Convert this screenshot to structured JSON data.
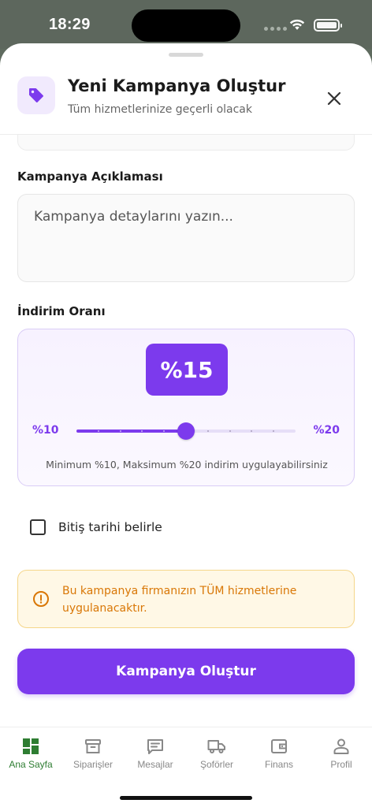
{
  "status_bar": {
    "time": "18:29"
  },
  "header": {
    "title": "Yeni Kampanya Oluştur",
    "subtitle": "Tüm hizmetlerinize geçerli olacak"
  },
  "description": {
    "label": "Kampanya Açıklaması",
    "placeholder": "Kampanya detaylarını yazın...",
    "value": ""
  },
  "discount": {
    "label": "İndirim Oranı",
    "display": "%15",
    "value": 15,
    "min": 10,
    "max": 20,
    "min_label": "%10",
    "max_label": "%20",
    "helper": "Minimum %10, Maksimum %20 indirim uygulayabilirsiniz",
    "accent_color": "#7c3aed"
  },
  "end_date": {
    "label": "Bitiş tarihi belirle",
    "checked": false
  },
  "info": {
    "text": "Bu kampanya firmanızın TÜM hizmetlerine uygulanacaktır."
  },
  "submit": {
    "label": "Kampanya Oluştur"
  },
  "tabs": [
    {
      "label": "Ana Sayfa",
      "icon": "dashboard-icon",
      "active": true
    },
    {
      "label": "Siparişler",
      "icon": "archive-box-icon",
      "active": false
    },
    {
      "label": "Mesajlar",
      "icon": "chat-icon",
      "active": false
    },
    {
      "label": "Şoförler",
      "icon": "truck-icon",
      "active": false
    },
    {
      "label": "Finans",
      "icon": "wallet-icon",
      "active": false
    },
    {
      "label": "Profil",
      "icon": "person-icon",
      "active": false
    }
  ],
  "colors": {
    "primary": "#7c3aed",
    "active_tab": "#2e7d32",
    "warning": "#d97706"
  }
}
